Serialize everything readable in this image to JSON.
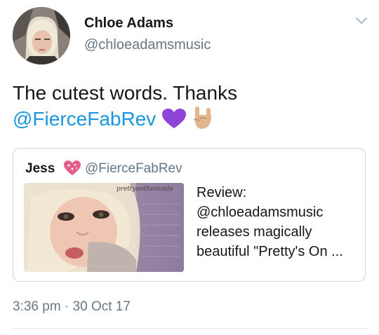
{
  "tweet": {
    "author": {
      "display_name": "Chloe Adams",
      "handle": "@chloeadamsmusic",
      "avatar_icon": "avatar-photo"
    },
    "text_line1": "The cutest words. Thanks",
    "mention": "@FierceFabRev",
    "emojis": [
      "purple-heart-icon",
      "rock-on-hand-icon"
    ],
    "timestamp": "3:36 pm · 30 Oct 17"
  },
  "quoted": {
    "display_name": "Jess",
    "name_icon": "sparkling-heart-icon",
    "handle": "@FierceFabRev",
    "thumbnail_caption": "prettyontheinside",
    "text": "Review: @chloeadamsmusic releases magically beautiful \"Pretty's On ..."
  },
  "colors": {
    "link": "#1b95e0",
    "secondary_text": "#657786",
    "border": "#ccd6dd",
    "purple_heart": "#8e44d6"
  }
}
